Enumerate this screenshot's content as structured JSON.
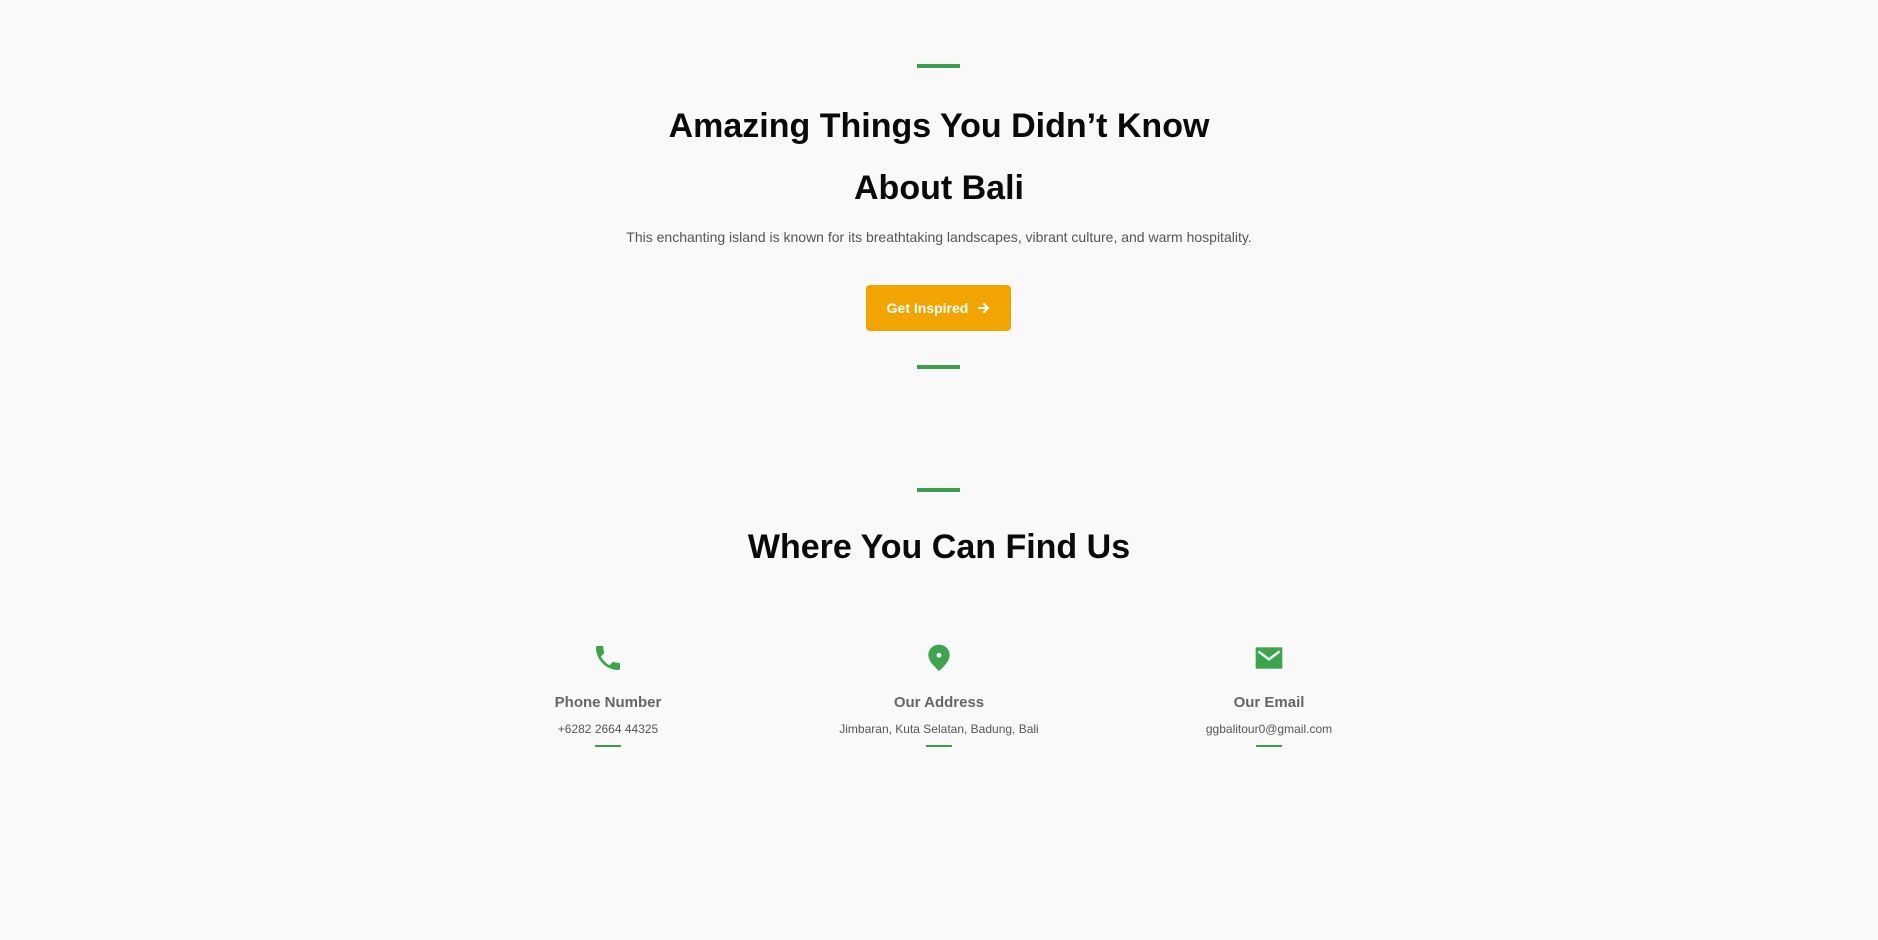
{
  "hero": {
    "title_line1": "Amazing Things You Didn’t Know",
    "title_line2": "About Bali",
    "subtitle": "This enchanting island is known for its breathtaking landscapes, vibrant culture, and warm hospitality.",
    "cta_label": "Get Inspired",
    "cta_icon": "arrow-right-icon"
  },
  "contact": {
    "title": "Where You Can Find Us",
    "items": [
      {
        "icon": "phone-icon",
        "label": "Phone Number",
        "value": "+6282 2664 44325"
      },
      {
        "icon": "map-pin-icon",
        "label": "Our Address",
        "value": "Jimbaran, Kuta Selatan, Badung, Bali"
      },
      {
        "icon": "mail-icon",
        "label": "Our Email",
        "value": "ggbalitour0@gmail.com"
      }
    ]
  },
  "colors": {
    "accent_green": "#3a9e4a",
    "cta_orange": "#f2a500",
    "background": "#f9f9f9"
  }
}
